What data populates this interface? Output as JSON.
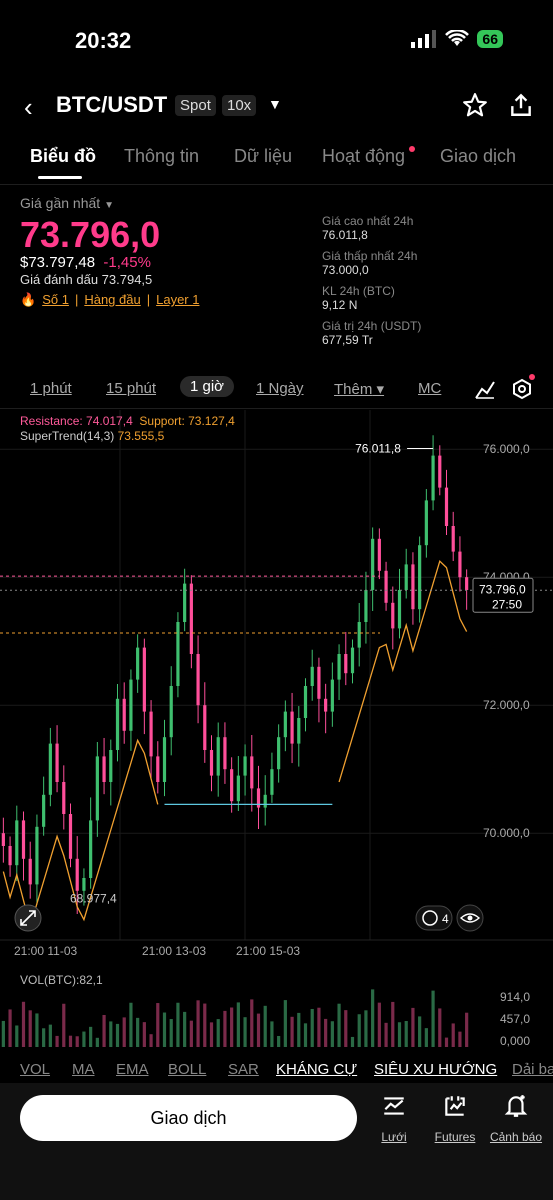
{
  "status": {
    "time": "20:32",
    "battery": "66"
  },
  "header": {
    "pair": "BTC/USDT",
    "market": "Spot",
    "leverage": "10x"
  },
  "tabs": [
    "Biểu đồ",
    "Thông tin",
    "Dữ liệu",
    "Hoạt động",
    "Giao dịch"
  ],
  "price": {
    "label": "Giá gần nhất",
    "last": "73.796,0",
    "usd": "$73.797,48",
    "change": "-1,45%",
    "mark": "Giá đánh dấu 73.794,5"
  },
  "tags": {
    "rank": "Số 1",
    "top": "Hàng đầu",
    "layer": "Layer 1"
  },
  "stats": [
    {
      "label": "Giá cao nhất 24h",
      "value": "76.011,8"
    },
    {
      "label": "Giá thấp nhất 24h",
      "value": "73.000,0"
    },
    {
      "label": "KL 24h (BTC)",
      "value": "9,12 N"
    },
    {
      "label": "Giá trị 24h (USDT)",
      "value": "677,59 Tr"
    }
  ],
  "intervals": [
    "1 phút",
    "15 phút",
    "1 giờ",
    "1 Ngày",
    "Thêm",
    "MC"
  ],
  "chart": {
    "resistance": "Resistance: 74.017,4",
    "support": "Support: 73.127,4",
    "supertrend_label": "SuperTrend(14,3)",
    "supertrend_value": "73.555,5",
    "high_label": "76.011,8",
    "low_label": "68.977,4",
    "price_tag": "73.796,0",
    "countdown": "27:50",
    "y_ticks": [
      "76.000,0",
      "74.000,0",
      "72.000,0",
      "70.000,0"
    ],
    "x_ticks": [
      "21:00 11-03",
      "21:00 13-03",
      "21:00 15-03"
    ],
    "indicator_count": "4"
  },
  "volume": {
    "label": "VOL(BTC):82,1",
    "ticks": [
      "914,0",
      "457,0",
      "0,000"
    ]
  },
  "indicators": [
    "VOL",
    "MA",
    "EMA",
    "BOLL",
    "SAR",
    "KHÁNG CỰ",
    "SIÊU XU HƯỚNG",
    "Dải ba"
  ],
  "bottom": {
    "trade": "Giao dịch",
    "grid": "Lưới",
    "futures": "Futures",
    "alert": "Cảnh báo"
  },
  "chart_data": {
    "type": "candlestick",
    "x_ticks": [
      "21:00 11-03",
      "21:00 13-03",
      "21:00 15-03"
    ],
    "y_ticks": [
      76000,
      74000,
      72000,
      70000
    ],
    "ylim": [
      68800,
      76300
    ],
    "high": 76011.8,
    "low": 68977.4,
    "last": 73796.0,
    "resistance": 74017.4,
    "support": 73127.4,
    "supertrend": 73555.5,
    "close_path": [
      69800,
      69500,
      70200,
      69600,
      69200,
      70100,
      70600,
      71400,
      70800,
      70300,
      69600,
      69100,
      69300,
      70200,
      71200,
      70800,
      71300,
      72100,
      71600,
      72400,
      72900,
      71900,
      71200,
      70800,
      71500,
      72300,
      73300,
      73900,
      72800,
      72000,
      71300,
      70900,
      71500,
      71000,
      70500,
      70900,
      71200,
      70700,
      70400,
      70600,
      71000,
      71500,
      71900,
      71400,
      71800,
      72300,
      72600,
      72100,
      71900,
      72400,
      72800,
      72500,
      72900,
      73300,
      73800,
      74600,
      74100,
      73600,
      73200,
      73800,
      74200,
      73500,
      74500,
      75200,
      75900,
      75400,
      74800,
      74400,
      74000,
      73800
    ]
  }
}
